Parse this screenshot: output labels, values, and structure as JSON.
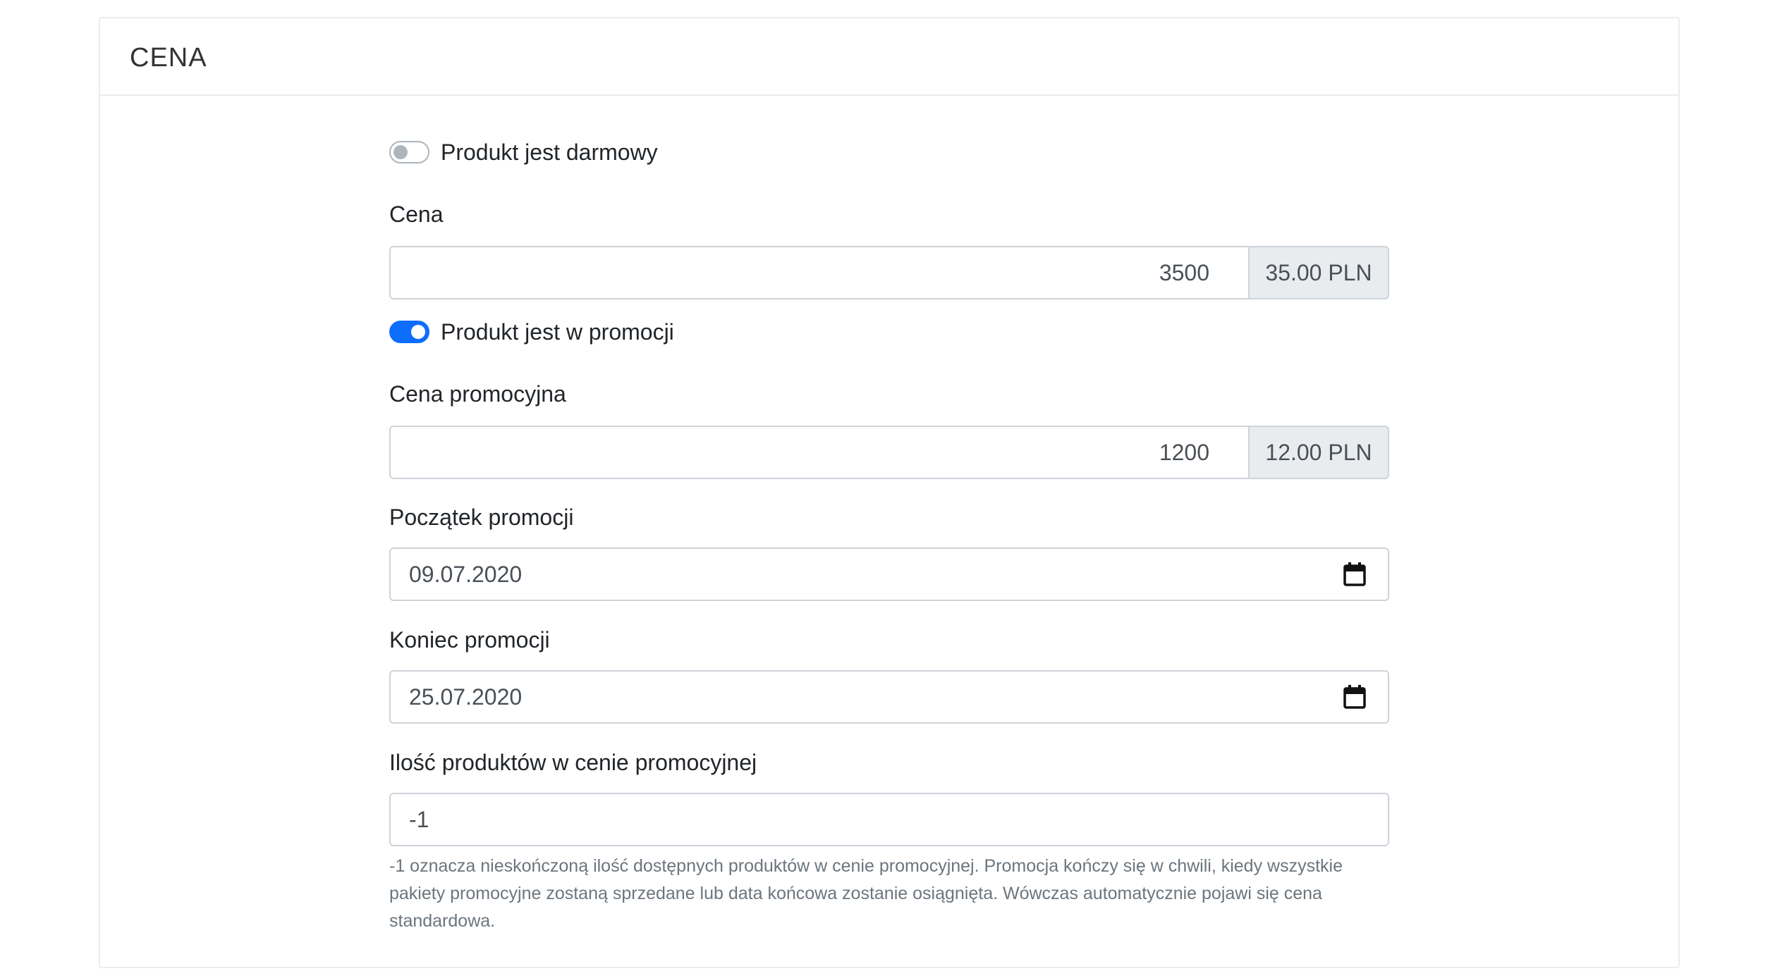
{
  "card": {
    "title": "CENA"
  },
  "free_switch": {
    "label": "Produkt jest darmowy",
    "checked": false
  },
  "price": {
    "label": "Cena",
    "value": "3500",
    "addon": "35.00 PLN"
  },
  "promo_switch": {
    "label": "Produkt jest w promocji",
    "checked": true
  },
  "promo_price": {
    "label": "Cena promocyjna",
    "value": "1200",
    "addon": "12.00 PLN"
  },
  "promo_start": {
    "label": "Początek promocji",
    "value": "09.07.2020",
    "icon": "calendar-icon"
  },
  "promo_end": {
    "label": "Koniec promocji",
    "value": "25.07.2020",
    "icon": "calendar-icon"
  },
  "promo_quantity": {
    "label": "Ilość produktów w cenie promocyjnej",
    "value": "-1",
    "help": "-1 oznacza nieskończoną ilość dostępnych produktów w cenie promocyjnej. Promocja kończy się w chwili, kiedy wszystkie pakiety promocyjne zostaną sprzedane lub data końcowa zostanie osiągnięta. Wówczas automatycznie pojawi się cena standardowa."
  },
  "colors": {
    "accent": "#0d6efd",
    "border": "#ced4da",
    "addon_bg": "#e9ecef",
    "help_text": "#6c757d"
  }
}
